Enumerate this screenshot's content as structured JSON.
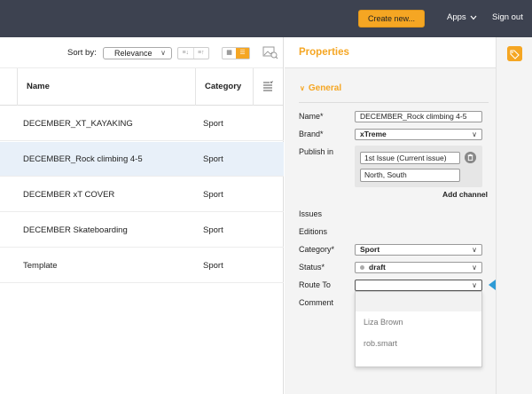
{
  "topbar": {
    "create_label": "Create new...",
    "apps_label": "Apps",
    "signout_label": "Sign out",
    "bg_color": "#3d4250",
    "accent_color": "#f5a623"
  },
  "list": {
    "sort_label": "Sort by:",
    "sort_value": "Relevance",
    "columns": {
      "name": "Name",
      "category": "Category"
    },
    "rows": [
      {
        "name": "DECEMBER_XT_KAYAKING",
        "category": "Sport",
        "selected": false
      },
      {
        "name": "DECEMBER_Rock climbing 4-5",
        "category": "Sport",
        "selected": true
      },
      {
        "name": "DECEMBER xT COVER",
        "category": "Sport",
        "selected": false
      },
      {
        "name": "DECEMBER Skateboarding",
        "category": "Sport",
        "selected": false
      },
      {
        "name": "Template",
        "category": "Sport",
        "selected": false
      }
    ]
  },
  "properties": {
    "title": "Properties",
    "section": "General",
    "labels": {
      "name": "Name*",
      "brand": "Brand*",
      "publish_in": "Publish in",
      "issues": "Issues",
      "editions": "Editions",
      "category": "Category*",
      "status": "Status*",
      "route_to": "Route To",
      "comment": "Comment"
    },
    "values": {
      "name": "DECEMBER_Rock climbing 4-5",
      "brand": "xTreme",
      "issue": "1st Issue (Current issue)",
      "publish_editions": "North, South",
      "category": "Sport",
      "status": "draft",
      "route_to": ""
    },
    "add_channel_label": "Add channel",
    "route_options": [
      "",
      "Liza Brown",
      "rob.smart"
    ]
  }
}
